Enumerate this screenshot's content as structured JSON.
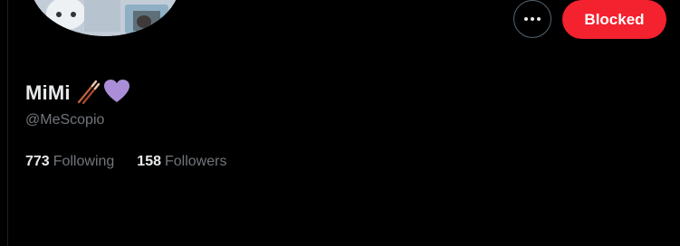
{
  "profile": {
    "display_name": "MiMi",
    "name_emojis": [
      "chopsticks-icon",
      "purple-heart-icon"
    ],
    "handle": "@MeScopio"
  },
  "actions": {
    "more_icon": "more-horizontal-icon",
    "blocked_label": "Blocked"
  },
  "stats": {
    "following_count": "773",
    "following_label": "Following",
    "followers_count": "158",
    "followers_label": "Followers"
  },
  "colors": {
    "background": "#000000",
    "primary_text": "#e7e9ea",
    "secondary_text": "#71767b",
    "blocked_red": "#f4212e",
    "heart_purple": "#ab8ed8"
  }
}
